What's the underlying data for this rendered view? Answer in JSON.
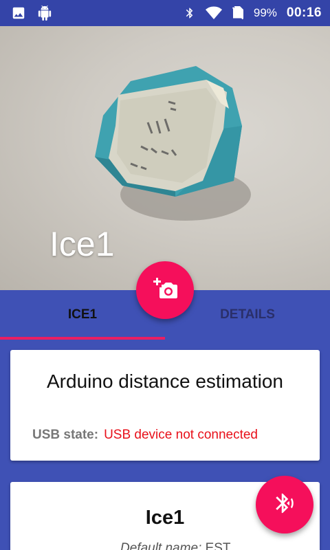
{
  "status_bar": {
    "icons_left": [
      "image-icon",
      "android-icon"
    ],
    "icons_right": [
      "bluetooth-icon",
      "wifi-icon",
      "no-sim-icon"
    ],
    "battery": "99%",
    "time": "00:16"
  },
  "header": {
    "title": "Ice1",
    "fab_icon": "add-photo-icon"
  },
  "tabs": [
    {
      "label": "ICE1",
      "active": true
    },
    {
      "label": "DETAILS",
      "active": false
    }
  ],
  "arduino_card": {
    "title": "Arduino distance estimation",
    "usb_label": "USB state:",
    "usb_value": "USB device not connected"
  },
  "beacon_card": {
    "title": "Ice1",
    "default_name_label": "Default name:",
    "default_name_value": "EST"
  },
  "fab_bluetooth_icon": "bluetooth-audio-icon",
  "colors": {
    "primary": "#3f51b5",
    "status_bar": "#3444a8",
    "accent": "#f50f5b",
    "tab_indicator": "#e91e63",
    "error_text": "#e8101a"
  }
}
